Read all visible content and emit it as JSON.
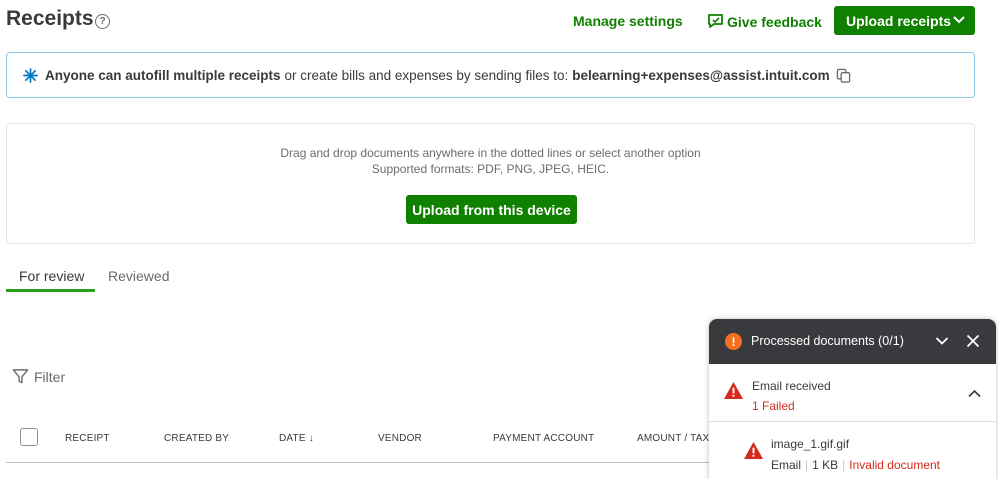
{
  "header": {
    "title": "Receipts",
    "help_glyph": "?",
    "manage_settings": "Manage settings",
    "give_feedback": "Give feedback",
    "upload_receipts": "Upload receipts"
  },
  "banner": {
    "bold_text": "Anyone can autofill multiple receipts",
    "rest_text": "or create bills and expenses by sending files to:",
    "email": "belearning+expenses@assist.intuit.com"
  },
  "dropzone": {
    "line1": "Drag and drop documents anywhere in the dotted lines or select another option",
    "line2": "Supported formats: PDF, PNG, JPEG, HEIC.",
    "upload_button": "Upload from this device"
  },
  "tabs": [
    {
      "label": "For review",
      "active": true
    },
    {
      "label": "Reviewed",
      "active": false
    }
  ],
  "filter": {
    "label": "Filter"
  },
  "table": {
    "columns": [
      "RECEIPT",
      "CREATED BY",
      "DATE ↓",
      "VENDOR",
      "PAYMENT ACCOUNT",
      "AMOUNT / TAX"
    ]
  },
  "panel": {
    "badge_glyph": "!",
    "title": "Processed documents (0/1)",
    "group": {
      "label": "Email received",
      "status": "1 Failed"
    },
    "item": {
      "filename": "image_1.gif.gif",
      "source": "Email",
      "size": "1 KB",
      "error": "Invalid document"
    }
  },
  "colors": {
    "brand_green": "#108000",
    "tab_underline": "#2ca01c",
    "banner_border": "#8ec8e8",
    "error_red": "#d52b1e",
    "panel_header": "#393a3d",
    "warning_orange": "#f46f1e"
  }
}
